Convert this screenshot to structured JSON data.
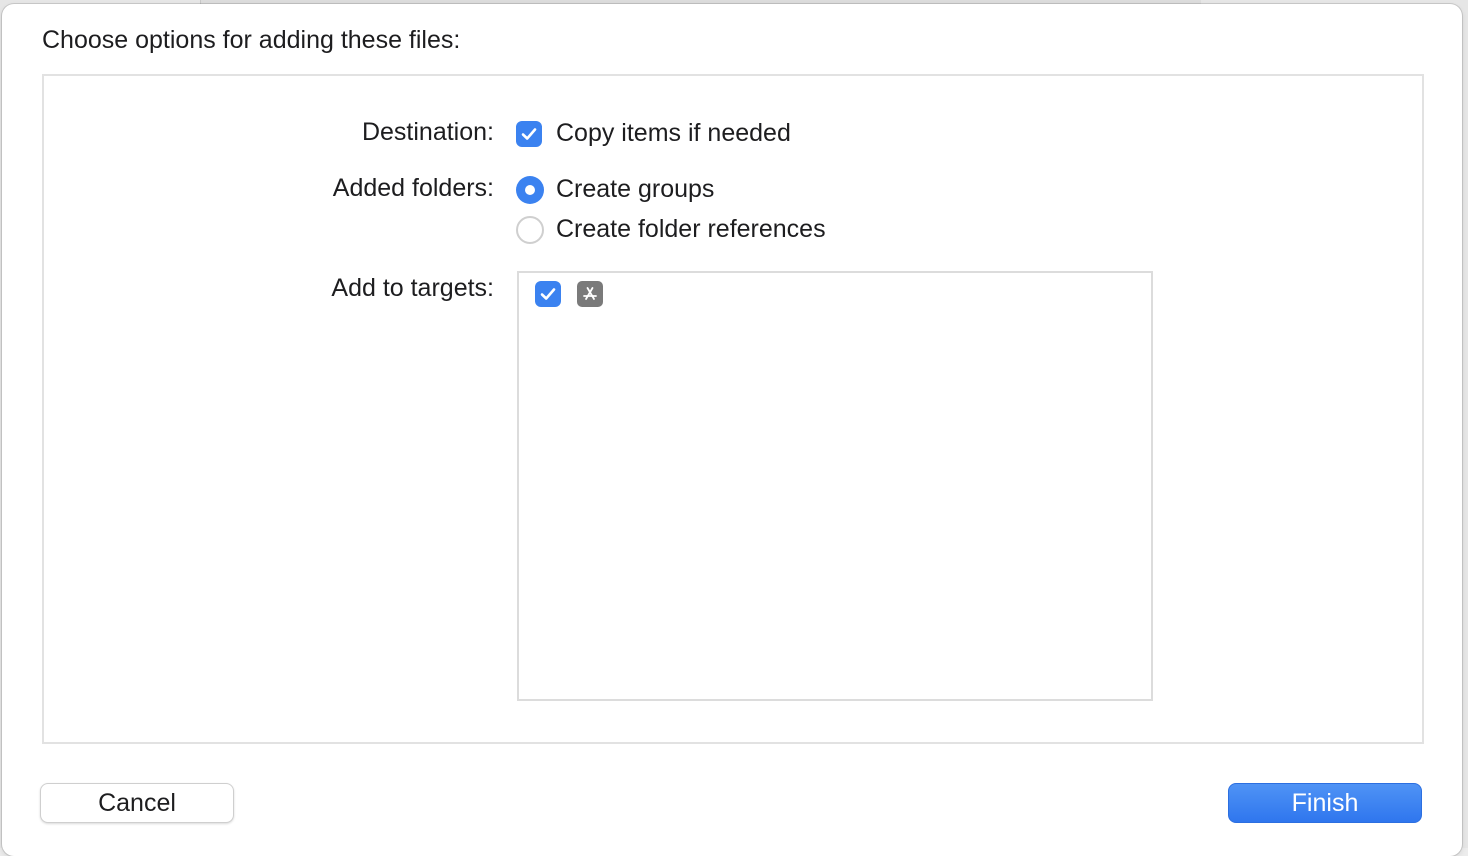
{
  "dialog": {
    "heading": "Choose options for adding these files:"
  },
  "destination": {
    "label": "Destination:",
    "copy_items": {
      "label": "Copy items if needed",
      "checked": true
    }
  },
  "added_folders": {
    "label": "Added folders:",
    "options": [
      {
        "label": "Create groups",
        "selected": true
      },
      {
        "label": "Create folder references",
        "selected": false
      }
    ]
  },
  "targets": {
    "label": "Add to targets:",
    "items": [
      {
        "checked": true,
        "icon": "app-store-icon"
      }
    ]
  },
  "buttons": {
    "cancel": "Cancel",
    "finish": "Finish"
  },
  "colors": {
    "accent": "#3b82f0",
    "panel_border": "#e2e2e2",
    "app_icon": "#7a7a7a"
  }
}
